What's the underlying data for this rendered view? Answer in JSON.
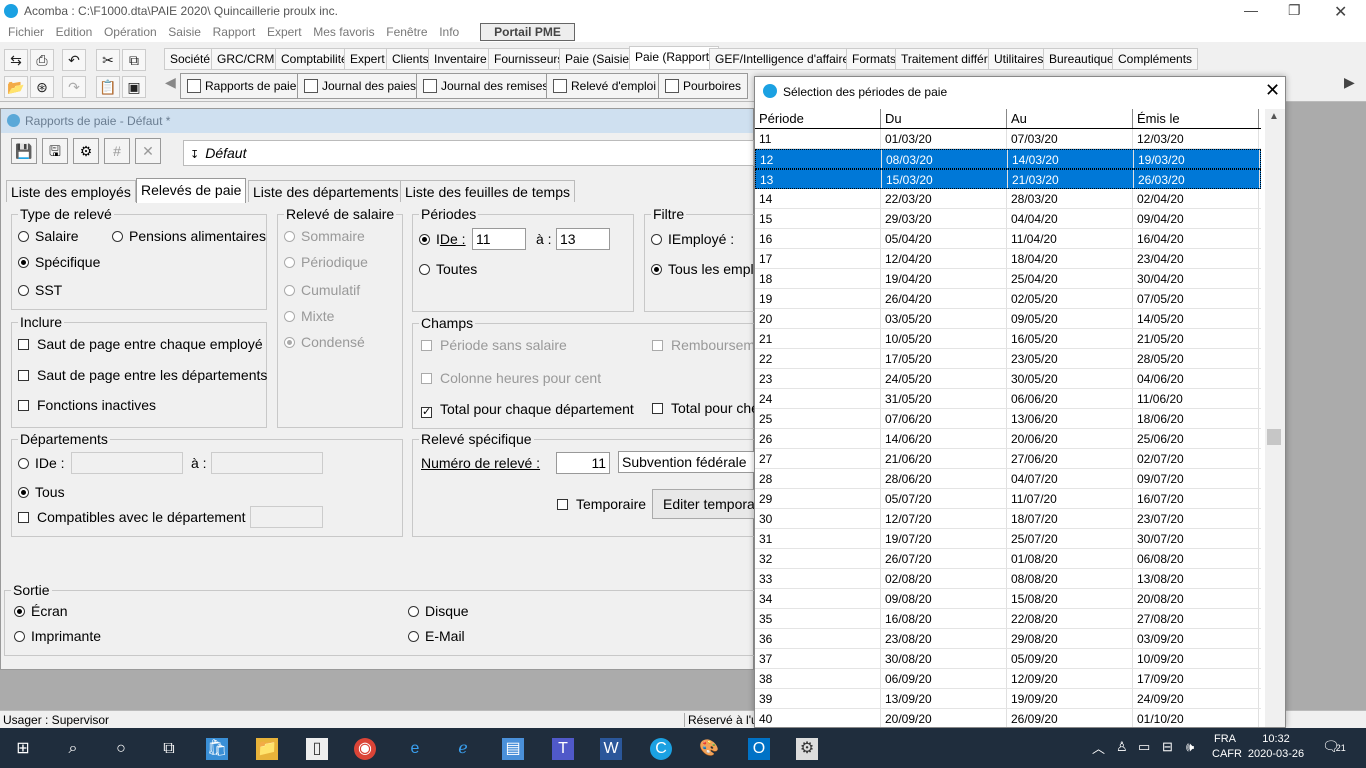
{
  "window": {
    "title": "Acomba : C:\\F1000.dta\\PAIE 2020\\  Quincaillerie proulx inc."
  },
  "menu": [
    "Fichier",
    "Edition",
    "Opération",
    "Saisie",
    "Rapport",
    "Expert",
    "Mes favoris",
    "Fenêtre",
    "Info"
  ],
  "portail": "Portail PME",
  "category_tabs": [
    "Société",
    "GRC/CRM",
    "Comptabilité",
    "Expert",
    "Clients",
    "Inventaire",
    "Fournisseurs",
    "Paie (Saisie)",
    "Paie (Rapport)",
    "GEF/Intelligence d'affaires",
    "Formats",
    "Traitement différé",
    "Utilitaires",
    "Bureautique",
    "Compléments"
  ],
  "report_tabs": [
    "Rapports de paie",
    "Journal des paies",
    "Journal des remises",
    "Relevé d'emploi",
    "Pourboires"
  ],
  "inner": {
    "title": "Rapports de paie - Défaut *",
    "format": "Défaut",
    "tabs": [
      "Liste des employés",
      "Relevés de paie",
      "Liste des départements",
      "Liste des feuilles de temps"
    ],
    "type_releve": {
      "legend": "Type de relevé",
      "salaire": "Salaire",
      "pensions": "Pensions alimentaires",
      "specifique": "Spécifique",
      "sst": "SST"
    },
    "releve_salaire": {
      "legend": "Relevé de salaire",
      "sommaire": "Sommaire",
      "periodique": "Périodique",
      "cumulatif": "Cumulatif",
      "mixte": "Mixte",
      "condense": "Condensé"
    },
    "periodes": {
      "legend": "Périodes",
      "de_label": "De :",
      "de_prefix": "I",
      "de_value": "11",
      "a_label": "à :",
      "a_value": "13",
      "toutes": "Toutes"
    },
    "filtre": {
      "legend": "Filtre",
      "employe": "Employé :",
      "employe_prefix": "I",
      "tous": "Tous les empl"
    },
    "inclure": {
      "legend": "Inclure",
      "opt1": "Saut de page entre chaque employé",
      "opt2": "Saut de page entre les départements",
      "opt3": "Fonctions inactives"
    },
    "champs": {
      "legend": "Champs",
      "periode_sans": "Période sans salaire",
      "rembourse": "Remboursem",
      "colonne": "Colonne heures pour cent",
      "total_dept": "Total pour chaque département",
      "total_che": "Total pour che"
    },
    "departements": {
      "legend": "Départements",
      "de_label": "De :",
      "de_prefix": "I",
      "a_label": "à :",
      "tous": "Tous",
      "compatibles": "Compatibles avec le département :"
    },
    "releve_specifique": {
      "legend": "Relevé spécifique",
      "numero_label": "Numéro de relevé :",
      "numero_value": "11",
      "description": "Subvention fédérale",
      "temporaire": "Temporaire",
      "editer": "Editer temporai"
    },
    "sortie": {
      "legend": "Sortie",
      "ecran": "Écran",
      "imprimante": "Imprimante",
      "disque": "Disque",
      "email": "E-Mail"
    }
  },
  "status": {
    "user": "Usager : Supervisor",
    "reserved": "Réservé à l'u"
  },
  "dialog": {
    "title": "Sélection des périodes de paie",
    "columns": [
      "Période",
      "Du",
      "Au",
      "Émis le"
    ],
    "rows": [
      [
        "11",
        "01/03/20",
        "07/03/20",
        "12/03/20"
      ],
      [
        "12",
        "08/03/20",
        "14/03/20",
        "19/03/20"
      ],
      [
        "13",
        "15/03/20",
        "21/03/20",
        "26/03/20"
      ],
      [
        "14",
        "22/03/20",
        "28/03/20",
        "02/04/20"
      ],
      [
        "15",
        "29/03/20",
        "04/04/20",
        "09/04/20"
      ],
      [
        "16",
        "05/04/20",
        "11/04/20",
        "16/04/20"
      ],
      [
        "17",
        "12/04/20",
        "18/04/20",
        "23/04/20"
      ],
      [
        "18",
        "19/04/20",
        "25/04/20",
        "30/04/20"
      ],
      [
        "19",
        "26/04/20",
        "02/05/20",
        "07/05/20"
      ],
      [
        "20",
        "03/05/20",
        "09/05/20",
        "14/05/20"
      ],
      [
        "21",
        "10/05/20",
        "16/05/20",
        "21/05/20"
      ],
      [
        "22",
        "17/05/20",
        "23/05/20",
        "28/05/20"
      ],
      [
        "23",
        "24/05/20",
        "30/05/20",
        "04/06/20"
      ],
      [
        "24",
        "31/05/20",
        "06/06/20",
        "11/06/20"
      ],
      [
        "25",
        "07/06/20",
        "13/06/20",
        "18/06/20"
      ],
      [
        "26",
        "14/06/20",
        "20/06/20",
        "25/06/20"
      ],
      [
        "27",
        "21/06/20",
        "27/06/20",
        "02/07/20"
      ],
      [
        "28",
        "28/06/20",
        "04/07/20",
        "09/07/20"
      ],
      [
        "29",
        "05/07/20",
        "11/07/20",
        "16/07/20"
      ],
      [
        "30",
        "12/07/20",
        "18/07/20",
        "23/07/20"
      ],
      [
        "31",
        "19/07/20",
        "25/07/20",
        "30/07/20"
      ],
      [
        "32",
        "26/07/20",
        "01/08/20",
        "06/08/20"
      ],
      [
        "33",
        "02/08/20",
        "08/08/20",
        "13/08/20"
      ],
      [
        "34",
        "09/08/20",
        "15/08/20",
        "20/08/20"
      ],
      [
        "35",
        "16/08/20",
        "22/08/20",
        "27/08/20"
      ],
      [
        "36",
        "23/08/20",
        "29/08/20",
        "03/09/20"
      ],
      [
        "37",
        "30/08/20",
        "05/09/20",
        "10/09/20"
      ],
      [
        "38",
        "06/09/20",
        "12/09/20",
        "17/09/20"
      ],
      [
        "39",
        "13/09/20",
        "19/09/20",
        "24/09/20"
      ],
      [
        "40",
        "20/09/20",
        "26/09/20",
        "01/10/20"
      ]
    ],
    "selected": [
      "12",
      "13"
    ]
  },
  "tray": {
    "lang1": "FRA",
    "lang2": "CAFR",
    "time": "10:32",
    "date": "2020-03-26",
    "notif": "21"
  }
}
